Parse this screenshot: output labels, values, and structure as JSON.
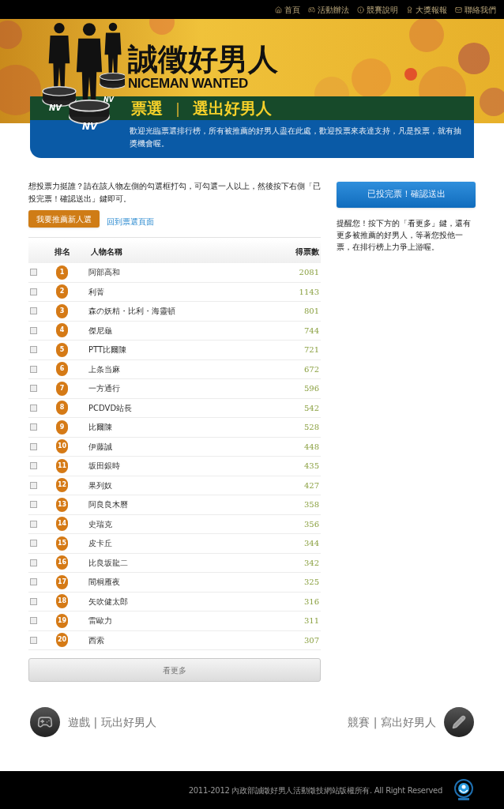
{
  "top_nav": [
    {
      "label": "首頁",
      "kind": "home"
    },
    {
      "label": "活動辦法",
      "kind": "game"
    },
    {
      "label": "競賽說明",
      "kind": "info"
    },
    {
      "label": "大獎報報",
      "kind": "award"
    },
    {
      "label": "聯絡我們",
      "kind": "mail"
    }
  ],
  "banner": {
    "trophy_marks": [
      "NV",
      "NV",
      "NV"
    ],
    "title": "誠徵好男人",
    "subtitle": "NICEMAN WANTED",
    "section": "票選",
    "divider": "|",
    "section_title": "選出好男人",
    "description": "歡迎光臨票選排行榜，所有被推薦的好男人盡在此處，歡迎投票來表達支持，凡是投票，就有抽獎機會喔。"
  },
  "intro": "想投票力挺誰？請在該人物左側的勾選框打勾，可勾選一人以上，然後按下右側「已投完票！確認送出」鍵即可。",
  "recommend_button": "我要推薦新人選",
  "back_link": "回到票選頁面",
  "table": {
    "columns": [
      "排名",
      "人物名稱",
      "得票數"
    ],
    "rows": [
      {
        "checked": false,
        "rank": "1",
        "name": "阿部高和",
        "votes": "2081"
      },
      {
        "checked": false,
        "rank": "2",
        "name": "利菁",
        "votes": "1143"
      },
      {
        "checked": false,
        "rank": "3",
        "name": "森の妖精・比利・海靈頓",
        "votes": "801"
      },
      {
        "checked": false,
        "rank": "4",
        "name": "傑尼龜",
        "votes": "744"
      },
      {
        "checked": false,
        "rank": "5",
        "name": "PTT比爾陳",
        "votes": "721"
      },
      {
        "checked": false,
        "rank": "6",
        "name": "上条当麻",
        "votes": "672"
      },
      {
        "checked": false,
        "rank": "7",
        "name": "一方通行",
        "votes": "596"
      },
      {
        "checked": false,
        "rank": "8",
        "name": "PCDVD站長",
        "votes": "542"
      },
      {
        "checked": false,
        "rank": "9",
        "name": "比爾陳",
        "votes": "528"
      },
      {
        "checked": false,
        "rank": "10",
        "name": "伊藤誠",
        "votes": "448"
      },
      {
        "checked": false,
        "rank": "11",
        "name": "坂田銀時",
        "votes": "435"
      },
      {
        "checked": false,
        "rank": "12",
        "name": "果列奴",
        "votes": "427"
      },
      {
        "checked": false,
        "rank": "13",
        "name": "阿良良木曆",
        "votes": "358"
      },
      {
        "checked": false,
        "rank": "14",
        "name": "史瑞克",
        "votes": "356"
      },
      {
        "checked": false,
        "rank": "15",
        "name": "皮卡丘",
        "votes": "344"
      },
      {
        "checked": false,
        "rank": "16",
        "name": "比良坂龍二",
        "votes": "342"
      },
      {
        "checked": false,
        "rank": "17",
        "name": "間桐雁夜",
        "votes": "325"
      },
      {
        "checked": false,
        "rank": "18",
        "name": "矢吹健太郎",
        "votes": "316"
      },
      {
        "checked": false,
        "rank": "19",
        "name": "雷歐力",
        "votes": "311"
      },
      {
        "checked": false,
        "rank": "20",
        "name": "西索",
        "votes": "307"
      }
    ]
  },
  "more_button": "看更多",
  "submit_button": "已投完票！確認送出",
  "reminder": "提醒您！按下方的「看更多」鍵，還有更多被推薦的好男人，等著您投他一票，在排行榜上力爭上游喔。",
  "footer_links": [
    {
      "kind": "game",
      "section": "遊戲",
      "divider": "|",
      "title": "玩出好男人"
    },
    {
      "kind": "pen",
      "section": "競賽",
      "divider": "|",
      "title": "寫出好男人"
    }
  ],
  "copyright": "2011-2012 內政部誠徵好男人活動徵技網站版權所有. All Right Reserved"
}
